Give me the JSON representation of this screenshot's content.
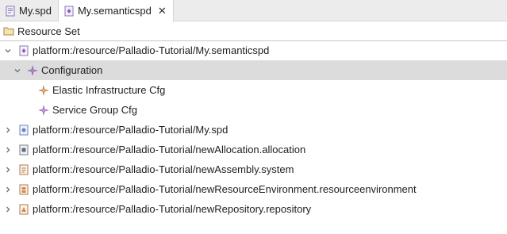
{
  "tabs": [
    {
      "label": "My.spd",
      "active": false,
      "icon": "spd-file-icon"
    },
    {
      "label": "My.semanticspd",
      "active": true,
      "icon": "semanticspd-file-icon",
      "close": "✕"
    }
  ],
  "tree": {
    "root": {
      "label": "Resource Set",
      "icon": "folder-icon"
    },
    "items": [
      {
        "label": "platform:/resource/Palladio-Tutorial/My.semanticspd",
        "expanded": true,
        "icon": "model-file-icon"
      },
      {
        "label": "Configuration",
        "expanded": true,
        "selected": true,
        "icon": "configuration-node-icon"
      },
      {
        "label": "Elastic Infrastructure Cfg",
        "icon": "elastic-infrastructure-icon"
      },
      {
        "label": "Service Group Cfg",
        "icon": "service-group-icon"
      },
      {
        "label": "platform:/resource/Palladio-Tutorial/My.spd",
        "expanded": false,
        "icon": "model-file-icon"
      },
      {
        "label": "platform:/resource/Palladio-Tutorial/newAllocation.allocation",
        "expanded": false,
        "icon": "model-file-icon"
      },
      {
        "label": "platform:/resource/Palladio-Tutorial/newAssembly.system",
        "expanded": false,
        "icon": "model-file-icon"
      },
      {
        "label": "platform:/resource/Palladio-Tutorial/newResourceEnvironment.resourceenvironment",
        "expanded": false,
        "icon": "model-file-icon"
      },
      {
        "label": "platform:/resource/Palladio-Tutorial/newRepository.repository",
        "expanded": false,
        "icon": "model-file-icon"
      }
    ]
  },
  "colors": {
    "selection": "#dcdcdc",
    "tabbar": "#ececec",
    "accent_purple": "#9b59b6",
    "accent_orange": "#c0703a"
  }
}
